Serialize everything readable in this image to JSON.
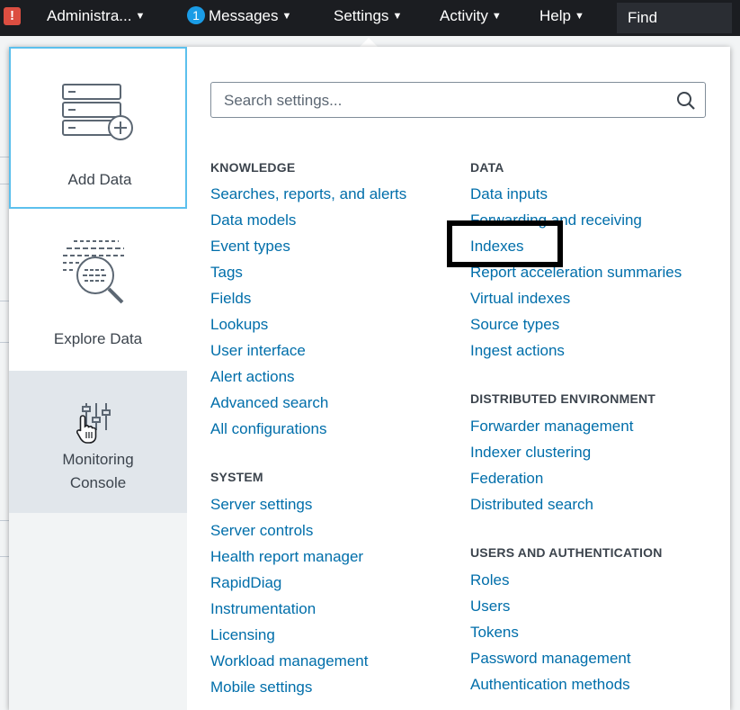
{
  "topbar": {
    "alert_badge": "!",
    "account_label": "Administra...",
    "messages_count": "1",
    "messages_label": "Messages",
    "settings_label": "Settings",
    "activity_label": "Activity",
    "help_label": "Help",
    "find_label": "Find"
  },
  "panel": {
    "tiles": {
      "add_data": "Add Data",
      "explore_data": "Explore Data",
      "monitoring_line1": "Monitoring",
      "monitoring_line2": "Console"
    },
    "search": {
      "placeholder": "Search settings..."
    },
    "knowledge": {
      "title": "KNOWLEDGE",
      "items": [
        "Searches, reports, and alerts",
        "Data models",
        "Event types",
        "Tags",
        "Fields",
        "Lookups",
        "User interface",
        "Alert actions",
        "Advanced search",
        "All configurations"
      ]
    },
    "system": {
      "title": "SYSTEM",
      "items": [
        "Server settings",
        "Server controls",
        "Health report manager",
        "RapidDiag",
        "Instrumentation",
        "Licensing",
        "Workload management",
        "Mobile settings"
      ]
    },
    "data": {
      "title": "DATA",
      "items": [
        "Data inputs",
        "Forwarding and receiving",
        "Indexes",
        "Report acceleration summaries",
        "Virtual indexes",
        "Source types",
        "Ingest actions"
      ]
    },
    "distributed": {
      "title": "DISTRIBUTED ENVIRONMENT",
      "items": [
        "Forwarder management",
        "Indexer clustering",
        "Federation",
        "Distributed search"
      ]
    },
    "users": {
      "title": "USERS AND AUTHENTICATION",
      "items": [
        "Roles",
        "Users",
        "Tokens",
        "Password management",
        "Authentication methods"
      ]
    }
  },
  "colors": {
    "link": "#006eaa",
    "topbar": "#1b1d21",
    "accent_border": "#5cc0ed",
    "alert": "#dc4e41",
    "badge": "#1a9ce6"
  },
  "icons": {
    "add_data": "server-plus-icon",
    "explore_data": "magnifier-data-icon",
    "monitoring": "sliders-icon",
    "cursor": "hand-pointer-icon",
    "search": "search-icon"
  }
}
